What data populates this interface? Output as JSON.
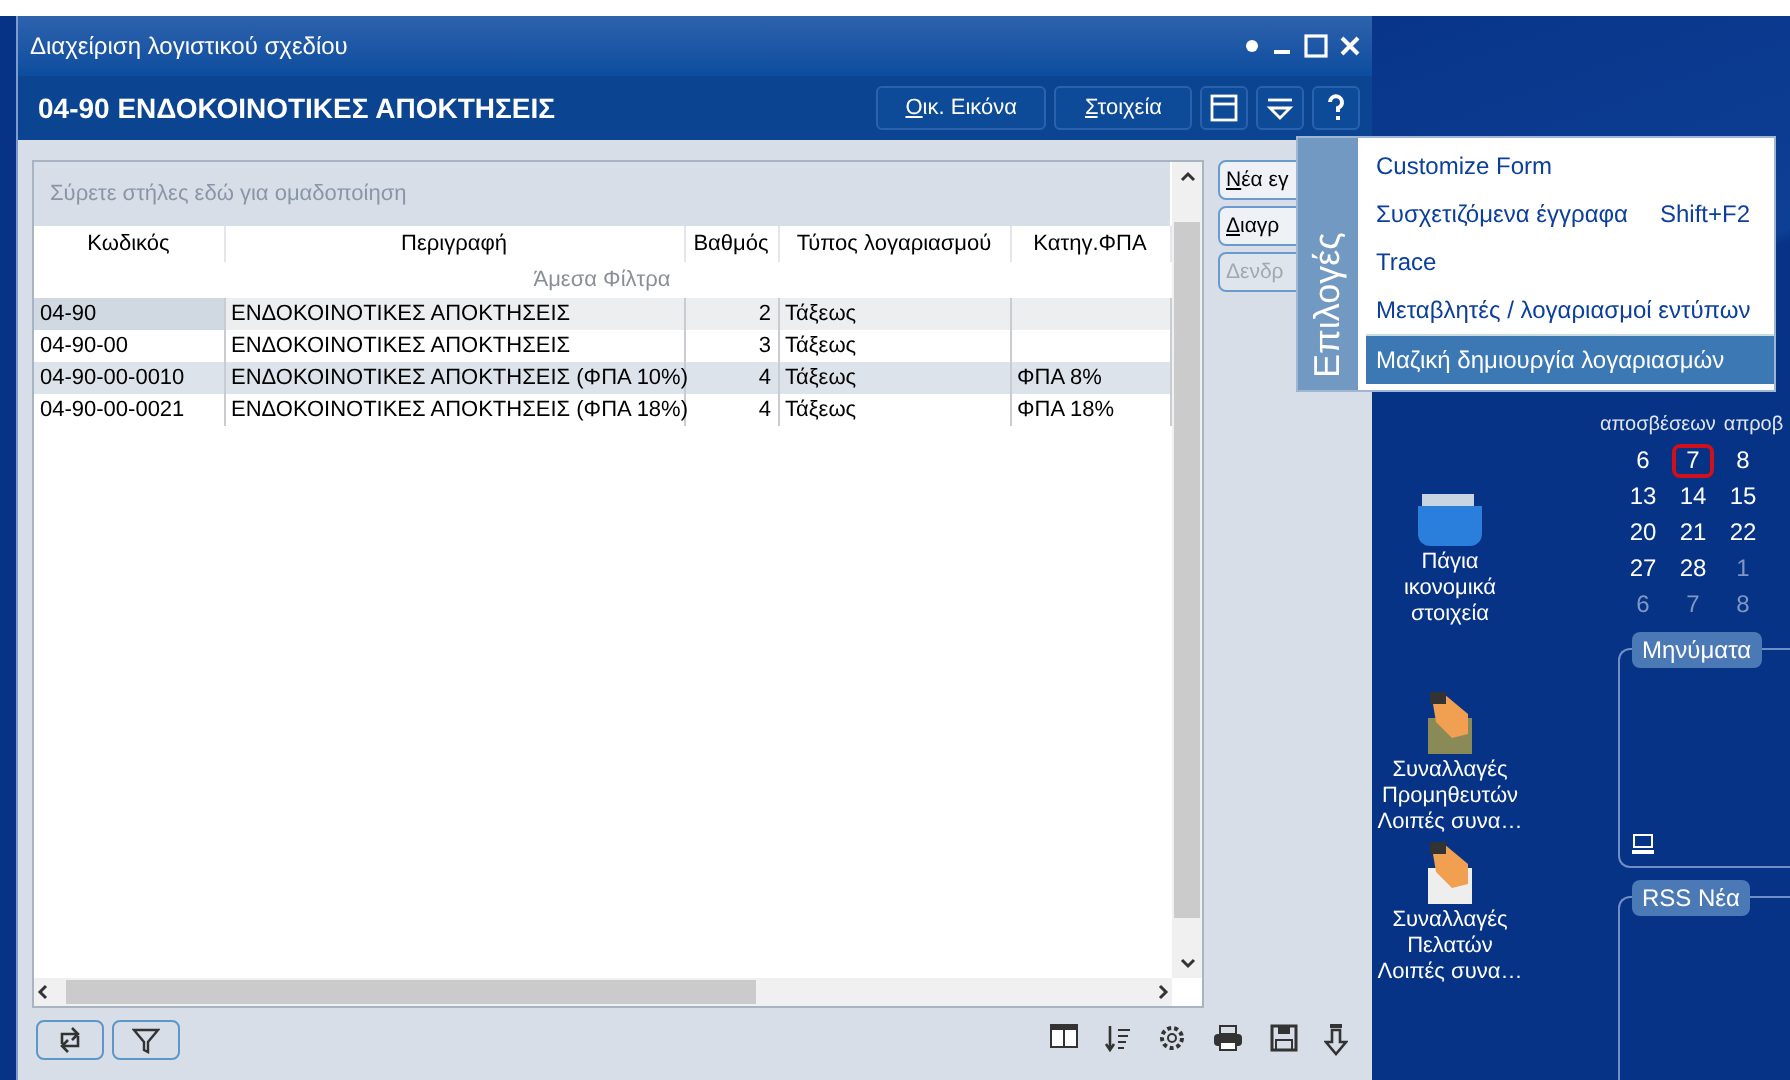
{
  "window": {
    "title": "Διαχείριση λογιστικού σχεδίου"
  },
  "header": {
    "title": "04-90 ΕΝΔΟΚΟΙΝΟΤΙΚΕΣ ΑΠΟΚΤΗΣΕΙΣ",
    "buttons": [
      {
        "label": "Οικ. Εικόνα"
      },
      {
        "label": "Στοιχεία"
      }
    ]
  },
  "grid": {
    "group_hint": "Σύρετε στήλες εδώ για ομαδοποίηση",
    "columns": [
      "Κωδικός",
      "Περιγραφή",
      "Βαθμός",
      "Τύπος λογαριασμού",
      "Κατηγ.ΦΠΑ"
    ],
    "filter_row": "Άμεσα Φίλτρα",
    "rows": [
      {
        "cells": [
          "04-90",
          "ΕΝΔΟΚΟΙΝΟΤΙΚΕΣ ΑΠΟΚΤΗΣΕΙΣ",
          "2",
          "Τάξεως",
          ""
        ],
        "selected": true
      },
      {
        "cells": [
          "04-90-00",
          "ΕΝΔΟΚΟΙΝΟΤΙΚΕΣ ΑΠΟΚΤΗΣΕΙΣ",
          "3",
          "Τάξεως",
          ""
        ],
        "selected": false
      },
      {
        "cells": [
          "04-90-00-0010",
          "ΕΝΔΟΚΟΙΝΟΤΙΚΕΣ ΑΠΟΚΤΗΣΕΙΣ (ΦΠΑ 10%)",
          "4",
          "Τάξεως",
          "ΦΠΑ 8%"
        ],
        "selected": false
      },
      {
        "cells": [
          "04-90-00-0021",
          "ΕΝΔΟΚΟΙΝΟΤΙΚΕΣ ΑΠΟΚΤΗΣΕΙΣ (ΦΠΑ 18%)",
          "4",
          "Τάξεως",
          "ΦΠΑ 18%"
        ],
        "selected": false
      }
    ]
  },
  "side_buttons": [
    {
      "label": "Νέα εγ",
      "disabled": false
    },
    {
      "label": "Διαγρ",
      "disabled": false
    },
    {
      "label": "Δενδρ",
      "disabled": true
    }
  ],
  "menu": {
    "title": "Επιλογές",
    "items": [
      {
        "label": "Customize Form",
        "selected": false
      },
      {
        "label": "Συσχετιζόμενα έγγραφα",
        "shortcut": "Shift+F2",
        "selected": false
      },
      {
        "label": "Trace",
        "selected": false
      },
      {
        "label": "Μεταβλητές / λογαριασμοί εντύπων",
        "selected": false
      },
      {
        "label": "Μαζική δημιουργία λογαριασμών",
        "selected": true
      }
    ]
  },
  "desktop": {
    "shortcuts": [
      {
        "lines": [
          "Πάγια",
          "ικονομικά",
          "στοιχεία"
        ],
        "kind": "folder"
      },
      {
        "lines": [
          "Συναλλαγές",
          "Προμηθευτών",
          "Λοιπές συνα…"
        ],
        "kind": "hand"
      },
      {
        "lines": [
          "Συναλλαγές",
          "Πελατών",
          "Λοιπές συνα…"
        ],
        "kind": "hand-light"
      }
    ],
    "calendar": {
      "headers": [
        "αποσβέσεων",
        "απροβ"
      ],
      "weeks": [
        [
          {
            "day": "6",
            "muted": false,
            "selected": false
          },
          {
            "day": "7",
            "muted": false,
            "selected": true
          },
          {
            "day": "8",
            "muted": false,
            "selected": false
          }
        ],
        [
          {
            "day": "13",
            "muted": false,
            "selected": false
          },
          {
            "day": "14",
            "muted": false,
            "selected": false
          },
          {
            "day": "15",
            "muted": false,
            "selected": false
          }
        ],
        [
          {
            "day": "20",
            "muted": false,
            "selected": false
          },
          {
            "day": "21",
            "muted": false,
            "selected": false
          },
          {
            "day": "22",
            "muted": false,
            "selected": false
          }
        ],
        [
          {
            "day": "27",
            "muted": false,
            "selected": false
          },
          {
            "day": "28",
            "muted": false,
            "selected": false
          },
          {
            "day": "1",
            "muted": true,
            "selected": false
          }
        ],
        [
          {
            "day": "6",
            "muted": true,
            "selected": false
          },
          {
            "day": "7",
            "muted": true,
            "selected": false
          },
          {
            "day": "8",
            "muted": true,
            "selected": false
          }
        ]
      ]
    },
    "panels": [
      {
        "title": "Μηνύματα",
        "kind": "messages"
      },
      {
        "title": "RSS Νέα",
        "kind": "rss"
      }
    ]
  }
}
